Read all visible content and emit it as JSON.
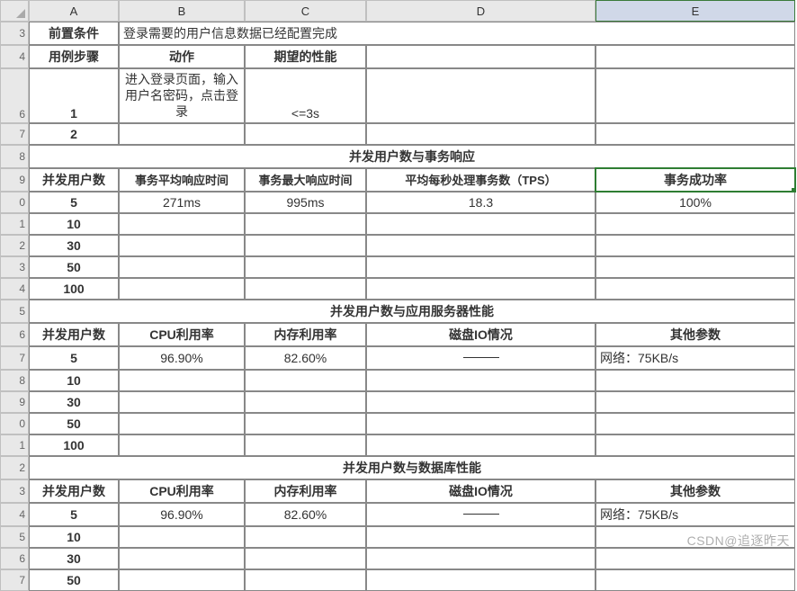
{
  "column_headers": [
    "A",
    "B",
    "C",
    "D",
    "E"
  ],
  "row3": {
    "label": "前置条件",
    "content": "登录需要的用户信息数据已经配置完成"
  },
  "row4": {
    "label": "用例步骤",
    "action_hdr": "动作",
    "expect_hdr": "期望的性能"
  },
  "row5": {
    "step": "1",
    "action": "进入登录页面，输入用户名密码，点击登录",
    "expect": "<=3s"
  },
  "row6": {
    "step": "2"
  },
  "section1": {
    "title": "并发用户数与事务响应",
    "headers": [
      "并发用户数",
      "事务平均响应时间",
      "事务最大响应时间",
      "平均每秒处理事务数（TPS）",
      "事务成功率"
    ],
    "rows": [
      {
        "users": "5",
        "avg": "271ms",
        "max": "995ms",
        "tps": "18.3",
        "success": "100%"
      },
      {
        "users": "10"
      },
      {
        "users": "30"
      },
      {
        "users": "50"
      },
      {
        "users": "100"
      }
    ]
  },
  "section2": {
    "title": "并发用户数与应用服务器性能",
    "headers": [
      "并发用户数",
      "CPU利用率",
      "内存利用率",
      "磁盘IO情况",
      "其他参数"
    ],
    "rows": [
      {
        "users": "5",
        "cpu": "96.90%",
        "mem": "82.60%",
        "disk": "—",
        "other": "网络：75KB/s"
      },
      {
        "users": "10"
      },
      {
        "users": "30"
      },
      {
        "users": "50"
      },
      {
        "users": "100"
      }
    ]
  },
  "section3": {
    "title": "并发用户数与数据库性能",
    "headers": [
      "并发用户数",
      "CPU利用率",
      "内存利用率",
      "磁盘IO情况",
      "其他参数"
    ],
    "rows": [
      {
        "users": "5",
        "cpu": "96.90%",
        "mem": "82.60%",
        "disk": "—",
        "other": "网络：75KB/s"
      },
      {
        "users": "10"
      },
      {
        "users": "30"
      },
      {
        "users": "50"
      }
    ]
  },
  "watermark": "CSDN@追逐昨天"
}
